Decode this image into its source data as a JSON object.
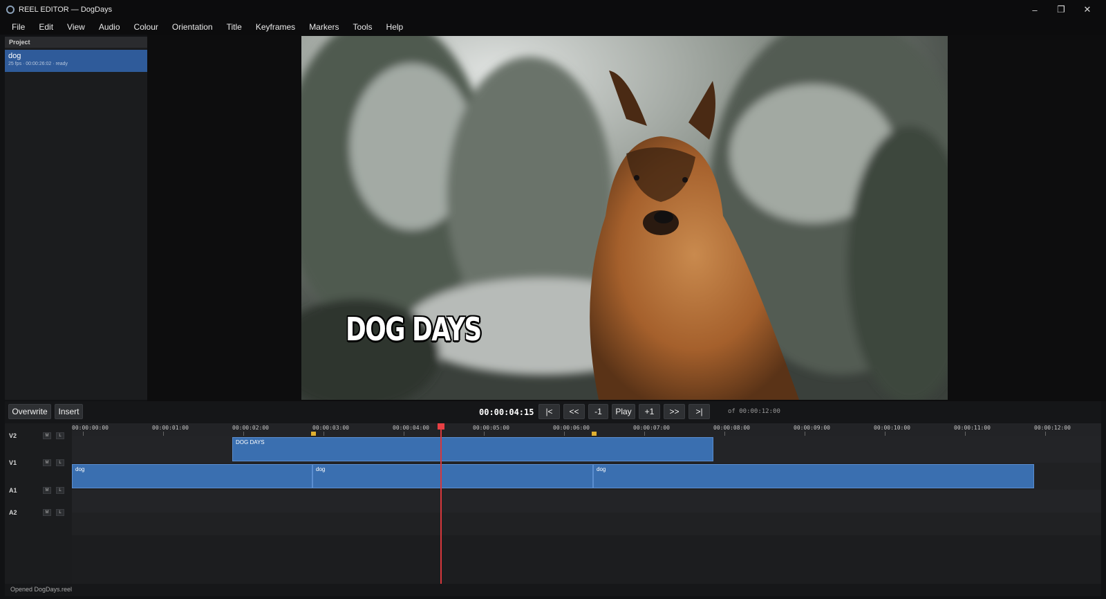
{
  "window": {
    "title": "REEL EDITOR — DogDays",
    "controls": {
      "minimize": "–",
      "maximize": "❐",
      "close": "✕"
    }
  },
  "menu": [
    "File",
    "Edit",
    "View",
    "Audio",
    "Colour",
    "Orientation",
    "Title",
    "Keyframes",
    "Markers",
    "Tools",
    "Help"
  ],
  "project": {
    "header": "Project",
    "items": [
      {
        "name": "dog",
        "meta": "25 fps · 00:00:26:02 · ready"
      }
    ]
  },
  "viewer": {
    "overlay_text": "DOG DAYS"
  },
  "transport": {
    "overwrite": "Overwrite",
    "insert": "Insert",
    "timecode": "00:00:04:15",
    "buttons": [
      "|<",
      "<<",
      "-1",
      "Play",
      "+1",
      ">>",
      ">|"
    ],
    "duration": "of 00:00:12:00"
  },
  "timeline": {
    "ruler": [
      "00:00:00:00",
      "00:00:01:00",
      "00:00:02:00",
      "00:00:03:00",
      "00:00:04:00",
      "00:00:05:00",
      "00:00:06:00",
      "00:00:07:00",
      "00:00:08:00",
      "00:00:09:00",
      "00:00:10:00",
      "00:00:11:00",
      "00:00:12:00"
    ],
    "tracks": [
      {
        "name": "V2",
        "mute": "M",
        "lock": "L"
      },
      {
        "name": "V1",
        "mute": "M",
        "lock": "L"
      },
      {
        "name": "A1",
        "mute": "M",
        "lock": "L"
      },
      {
        "name": "A2",
        "mute": "M",
        "lock": "L"
      }
    ],
    "clips": {
      "v2": [
        {
          "label": "DOG DAYS",
          "start_s": 2.0,
          "end_s": 8.0
        }
      ],
      "v1": [
        {
          "label": "dog",
          "start_s": 0.0,
          "end_s": 3.0
        },
        {
          "label": "dog",
          "start_s": 3.0,
          "end_s": 6.5
        },
        {
          "label": "dog",
          "start_s": 6.5,
          "end_s": 12.0
        }
      ]
    },
    "markers_s": [
      3.0,
      6.5
    ],
    "playhead_s": 4.6
  },
  "status": "Opened DogDays.reel",
  "colors": {
    "clip": "#3a6fb0",
    "selection": "#2f5b9a",
    "playhead": "#d8383c",
    "marker": "#e0b030"
  }
}
